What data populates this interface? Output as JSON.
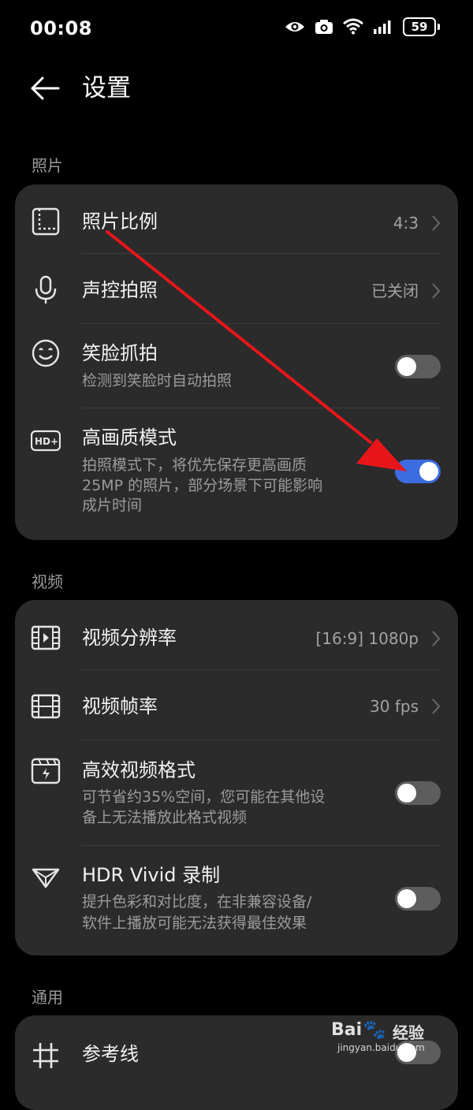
{
  "status": {
    "time": "00:08",
    "battery": "59"
  },
  "header": {
    "title": "设置"
  },
  "photo": {
    "label": "照片",
    "ratio": {
      "title": "照片比例",
      "value": "4:3"
    },
    "voice": {
      "title": "声控拍照",
      "value": "已关闭"
    },
    "smile": {
      "title": "笑脸抓拍",
      "desc": "检测到笑脸时自动拍照",
      "enabled": false
    },
    "hq": {
      "title": "高画质模式",
      "desc1": "拍照模式下，将优先保存更高画质",
      "desc2": "25MP 的照片，部分场景下可能影响",
      "desc3": "成片时间",
      "enabled": true
    }
  },
  "video": {
    "label": "视频",
    "resolution": {
      "title": "视频分辨率",
      "value": "[16:9] 1080p"
    },
    "framerate": {
      "title": "视频帧率",
      "value": "30 fps"
    },
    "efficient": {
      "title": "高效视频格式",
      "desc1": "可节省约35%空间，您可能在其他设",
      "desc2": "备上无法播放此格式视频",
      "enabled": false
    },
    "hdr": {
      "title": "HDR Vivid 录制",
      "desc1": "提升色彩和对比度，在非兼容设备/",
      "desc2": "软件上播放可能无法获得最佳效果",
      "enabled": false
    }
  },
  "general": {
    "label": "通用",
    "grid": {
      "title": "参考线",
      "enabled": false
    }
  },
  "watermark": {
    "brand": "Bai",
    "brand2": "经验",
    "site": "jingyan.baidu.com"
  },
  "colors": {
    "accent": "#3c6ce0",
    "card": "#2b2b2b",
    "annotation": "#e8161b"
  }
}
